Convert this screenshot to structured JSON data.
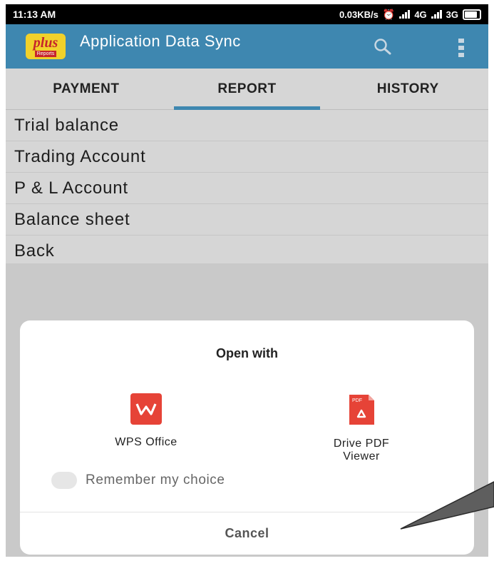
{
  "status_bar": {
    "time": "11:13 AM",
    "speed": "0.03KB/s",
    "net1": "4G",
    "net2": "3G"
  },
  "app_bar": {
    "logo_main": "plus",
    "logo_sub": "Reports",
    "title": "Application Data Sync",
    "accent": "#3e87b0"
  },
  "tabs": [
    {
      "label": "PAYMENT",
      "active": false
    },
    {
      "label": "REPORT",
      "active": true
    },
    {
      "label": "HISTORY",
      "active": false
    }
  ],
  "report_items": [
    {
      "label": "Trial balance"
    },
    {
      "label": "Trading Account"
    },
    {
      "label": "P & L Account"
    },
    {
      "label": "Balance sheet"
    },
    {
      "label": "Back"
    }
  ],
  "dialog": {
    "title": "Open with",
    "apps": [
      {
        "label": "WPS Office",
        "icon": "wps-office-icon",
        "color": "#e64337"
      },
      {
        "label": "Drive PDF\nViewer",
        "icon": "drive-pdf-icon",
        "color": "#e64337",
        "badge": "PDF"
      }
    ],
    "remember_label": "Remember my choice",
    "cancel_label": "Cancel"
  }
}
